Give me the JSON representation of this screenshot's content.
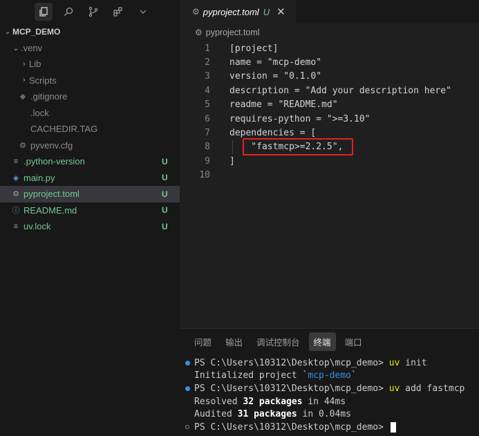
{
  "explorer": {
    "root": "MCP_DEMO",
    "items": [
      {
        "label": ".venv",
        "badge": ""
      },
      {
        "label": "Lib",
        "badge": ""
      },
      {
        "label": "Scripts",
        "badge": ""
      },
      {
        "label": ".gitignore",
        "badge": ""
      },
      {
        "label": ".lock",
        "badge": ""
      },
      {
        "label": "CACHEDIR.TAG",
        "badge": ""
      },
      {
        "label": "pyvenv.cfg",
        "badge": ""
      },
      {
        "label": ".python-version",
        "badge": "U"
      },
      {
        "label": "main.py",
        "badge": "U"
      },
      {
        "label": "pyproject.toml",
        "badge": "U"
      },
      {
        "label": "README.md",
        "badge": "U"
      },
      {
        "label": "uv.lock",
        "badge": "U"
      }
    ]
  },
  "editor": {
    "tab_title": "pyproject.toml",
    "tab_status": "U",
    "breadcrumb": "pyproject.toml",
    "lines": [
      {
        "n": "1",
        "text": "[project]"
      },
      {
        "n": "2",
        "text": "name = \"mcp-demo\""
      },
      {
        "n": "3",
        "text": "version = \"0.1.0\""
      },
      {
        "n": "4",
        "text": "description = \"Add your description here\""
      },
      {
        "n": "5",
        "text": "readme = \"README.md\""
      },
      {
        "n": "6",
        "text": "requires-python = \">=3.10\""
      },
      {
        "n": "7",
        "text": "dependencies = ["
      },
      {
        "n": "8",
        "text": "    \"fastmcp>=2.2.5\","
      },
      {
        "n": "9",
        "text": "]"
      },
      {
        "n": "10",
        "text": ""
      }
    ]
  },
  "panel": {
    "tabs": [
      "问题",
      "输出",
      "调试控制台",
      "终端",
      "端口"
    ],
    "active_tab": "终端"
  },
  "terminal": {
    "prompt": "PS C:\\Users\\10312\\Desktop\\mcp_demo> ",
    "cmd1": "uv",
    "arg1": " init",
    "init_prefix": "Initialized project `",
    "init_name": "mcp-demo",
    "init_suffix": "`",
    "cmd2": "uv",
    "arg2": " add fastmcp",
    "resolved_a": "Resolved ",
    "resolved_b": "32 packages",
    "resolved_c": " in 44ms",
    "audited_a": "Audited ",
    "audited_b": "31 packages",
    "audited_c": " in 0.04ms"
  },
  "colors": {
    "accent_highlight": "#e8201a",
    "untracked": "#73c991",
    "terminal_command": "#e5e510"
  }
}
